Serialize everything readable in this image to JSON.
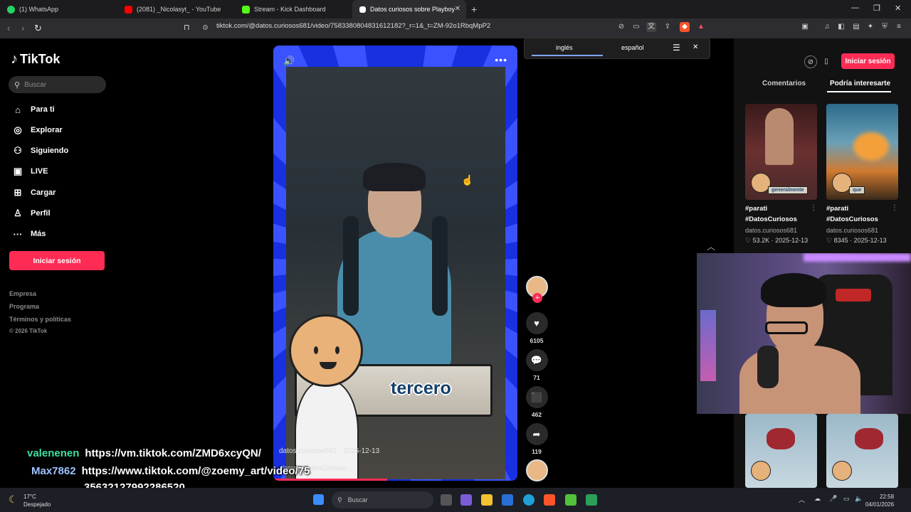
{
  "browser": {
    "tabs": [
      {
        "title": "(1) WhatsApp",
        "color": "#25d366"
      },
      {
        "title": "(2081) _Nicolasyt_ - YouTube",
        "color": "#ff0000"
      },
      {
        "title": "Stream - Kick Dashboard",
        "color": "#53fc18"
      },
      {
        "title": "Datos curiosos sobre Playboy",
        "color": "#ffffff"
      }
    ],
    "url": "tiktok.com/@datos.curiosos681/video/7583380804831612182?_r=1&_t=ZM-92o1RbqMpP2"
  },
  "translate": {
    "lang_from": "inglés",
    "lang_to": "español"
  },
  "sidebar": {
    "brand": "TikTok",
    "search_placeholder": "Buscar",
    "items": [
      {
        "label": "Para ti",
        "icon": "home-icon"
      },
      {
        "label": "Explorar",
        "icon": "compass-icon"
      },
      {
        "label": "Siguiendo",
        "icon": "following-icon"
      },
      {
        "label": "LIVE",
        "icon": "live-icon"
      },
      {
        "label": "Cargar",
        "icon": "upload-icon"
      },
      {
        "label": "Perfil",
        "icon": "profile-icon"
      },
      {
        "label": "Más",
        "icon": "more-icon"
      }
    ],
    "login": "Iniciar sesión",
    "footer": [
      "Empresa",
      "Programa",
      "Términos y políticas",
      "© 2026 TikTok"
    ]
  },
  "video": {
    "sign_text": "tercero",
    "author_line": "datos.curiosos681 · 2025-12-13",
    "desc": "#parati #DatosCuriosos ..."
  },
  "actions": {
    "likes": "6105",
    "comments": "71",
    "saves": "462",
    "shares": "119"
  },
  "right": {
    "login": "Iniciar sesión",
    "tab_comments": "Comentarios",
    "tab_suggest": "Podría interesarte",
    "cards": [
      {
        "tag": "#parati",
        "tag2": "#DatosCuriosos",
        "user": "datos.curiosos681",
        "stats": "♡ 53.2K · 2025-12-13",
        "label": "generalmente"
      },
      {
        "tag": "#parati",
        "tag2": "#DatosCuriosos",
        "user": "datos.curiosos681",
        "stats": "♡ 8345 · 2025-12-13",
        "label": "que"
      }
    ]
  },
  "chat": [
    {
      "user": "valenenen",
      "msg": "https://vm.tiktok.com/ZMD6xcyQN/"
    },
    {
      "user": "Max7862",
      "msg": "https://www.tiktok.com/@zoemy_art/video/75",
      "msg2": "35632127992286520"
    }
  ],
  "taskbar": {
    "temp": "17°C",
    "weather": "Despejado",
    "search": "Buscar",
    "time": "22:58",
    "date": "04/01/2026"
  }
}
